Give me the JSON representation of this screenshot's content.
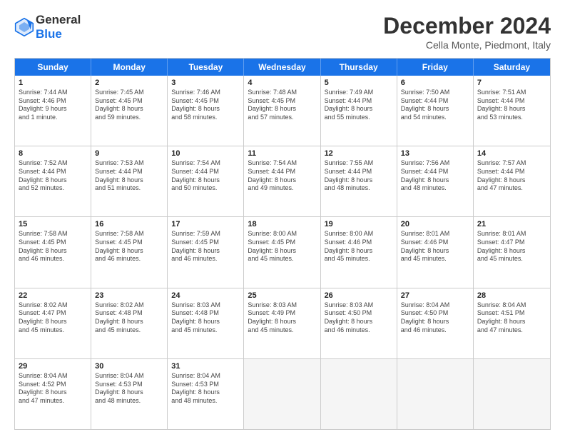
{
  "logo": {
    "line1": "General",
    "line2": "Blue"
  },
  "title": "December 2024",
  "subtitle": "Cella Monte, Piedmont, Italy",
  "days": [
    "Sunday",
    "Monday",
    "Tuesday",
    "Wednesday",
    "Thursday",
    "Friday",
    "Saturday"
  ],
  "weeks": [
    [
      {
        "day": "1",
        "lines": [
          "Sunrise: 7:44 AM",
          "Sunset: 4:46 PM",
          "Daylight: 9 hours",
          "and 1 minute."
        ]
      },
      {
        "day": "2",
        "lines": [
          "Sunrise: 7:45 AM",
          "Sunset: 4:45 PM",
          "Daylight: 8 hours",
          "and 59 minutes."
        ]
      },
      {
        "day": "3",
        "lines": [
          "Sunrise: 7:46 AM",
          "Sunset: 4:45 PM",
          "Daylight: 8 hours",
          "and 58 minutes."
        ]
      },
      {
        "day": "4",
        "lines": [
          "Sunrise: 7:48 AM",
          "Sunset: 4:45 PM",
          "Daylight: 8 hours",
          "and 57 minutes."
        ]
      },
      {
        "day": "5",
        "lines": [
          "Sunrise: 7:49 AM",
          "Sunset: 4:44 PM",
          "Daylight: 8 hours",
          "and 55 minutes."
        ]
      },
      {
        "day": "6",
        "lines": [
          "Sunrise: 7:50 AM",
          "Sunset: 4:44 PM",
          "Daylight: 8 hours",
          "and 54 minutes."
        ]
      },
      {
        "day": "7",
        "lines": [
          "Sunrise: 7:51 AM",
          "Sunset: 4:44 PM",
          "Daylight: 8 hours",
          "and 53 minutes."
        ]
      }
    ],
    [
      {
        "day": "8",
        "lines": [
          "Sunrise: 7:52 AM",
          "Sunset: 4:44 PM",
          "Daylight: 8 hours",
          "and 52 minutes."
        ]
      },
      {
        "day": "9",
        "lines": [
          "Sunrise: 7:53 AM",
          "Sunset: 4:44 PM",
          "Daylight: 8 hours",
          "and 51 minutes."
        ]
      },
      {
        "day": "10",
        "lines": [
          "Sunrise: 7:54 AM",
          "Sunset: 4:44 PM",
          "Daylight: 8 hours",
          "and 50 minutes."
        ]
      },
      {
        "day": "11",
        "lines": [
          "Sunrise: 7:54 AM",
          "Sunset: 4:44 PM",
          "Daylight: 8 hours",
          "and 49 minutes."
        ]
      },
      {
        "day": "12",
        "lines": [
          "Sunrise: 7:55 AM",
          "Sunset: 4:44 PM",
          "Daylight: 8 hours",
          "and 48 minutes."
        ]
      },
      {
        "day": "13",
        "lines": [
          "Sunrise: 7:56 AM",
          "Sunset: 4:44 PM",
          "Daylight: 8 hours",
          "and 48 minutes."
        ]
      },
      {
        "day": "14",
        "lines": [
          "Sunrise: 7:57 AM",
          "Sunset: 4:44 PM",
          "Daylight: 8 hours",
          "and 47 minutes."
        ]
      }
    ],
    [
      {
        "day": "15",
        "lines": [
          "Sunrise: 7:58 AM",
          "Sunset: 4:45 PM",
          "Daylight: 8 hours",
          "and 46 minutes."
        ]
      },
      {
        "day": "16",
        "lines": [
          "Sunrise: 7:58 AM",
          "Sunset: 4:45 PM",
          "Daylight: 8 hours",
          "and 46 minutes."
        ]
      },
      {
        "day": "17",
        "lines": [
          "Sunrise: 7:59 AM",
          "Sunset: 4:45 PM",
          "Daylight: 8 hours",
          "and 46 minutes."
        ]
      },
      {
        "day": "18",
        "lines": [
          "Sunrise: 8:00 AM",
          "Sunset: 4:45 PM",
          "Daylight: 8 hours",
          "and 45 minutes."
        ]
      },
      {
        "day": "19",
        "lines": [
          "Sunrise: 8:00 AM",
          "Sunset: 4:46 PM",
          "Daylight: 8 hours",
          "and 45 minutes."
        ]
      },
      {
        "day": "20",
        "lines": [
          "Sunrise: 8:01 AM",
          "Sunset: 4:46 PM",
          "Daylight: 8 hours",
          "and 45 minutes."
        ]
      },
      {
        "day": "21",
        "lines": [
          "Sunrise: 8:01 AM",
          "Sunset: 4:47 PM",
          "Daylight: 8 hours",
          "and 45 minutes."
        ]
      }
    ],
    [
      {
        "day": "22",
        "lines": [
          "Sunrise: 8:02 AM",
          "Sunset: 4:47 PM",
          "Daylight: 8 hours",
          "and 45 minutes."
        ]
      },
      {
        "day": "23",
        "lines": [
          "Sunrise: 8:02 AM",
          "Sunset: 4:48 PM",
          "Daylight: 8 hours",
          "and 45 minutes."
        ]
      },
      {
        "day": "24",
        "lines": [
          "Sunrise: 8:03 AM",
          "Sunset: 4:48 PM",
          "Daylight: 8 hours",
          "and 45 minutes."
        ]
      },
      {
        "day": "25",
        "lines": [
          "Sunrise: 8:03 AM",
          "Sunset: 4:49 PM",
          "Daylight: 8 hours",
          "and 45 minutes."
        ]
      },
      {
        "day": "26",
        "lines": [
          "Sunrise: 8:03 AM",
          "Sunset: 4:50 PM",
          "Daylight: 8 hours",
          "and 46 minutes."
        ]
      },
      {
        "day": "27",
        "lines": [
          "Sunrise: 8:04 AM",
          "Sunset: 4:50 PM",
          "Daylight: 8 hours",
          "and 46 minutes."
        ]
      },
      {
        "day": "28",
        "lines": [
          "Sunrise: 8:04 AM",
          "Sunset: 4:51 PM",
          "Daylight: 8 hours",
          "and 47 minutes."
        ]
      }
    ],
    [
      {
        "day": "29",
        "lines": [
          "Sunrise: 8:04 AM",
          "Sunset: 4:52 PM",
          "Daylight: 8 hours",
          "and 47 minutes."
        ]
      },
      {
        "day": "30",
        "lines": [
          "Sunrise: 8:04 AM",
          "Sunset: 4:53 PM",
          "Daylight: 8 hours",
          "and 48 minutes."
        ]
      },
      {
        "day": "31",
        "lines": [
          "Sunrise: 8:04 AM",
          "Sunset: 4:53 PM",
          "Daylight: 8 hours",
          "and 48 minutes."
        ]
      },
      {
        "day": "",
        "lines": []
      },
      {
        "day": "",
        "lines": []
      },
      {
        "day": "",
        "lines": []
      },
      {
        "day": "",
        "lines": []
      }
    ]
  ]
}
